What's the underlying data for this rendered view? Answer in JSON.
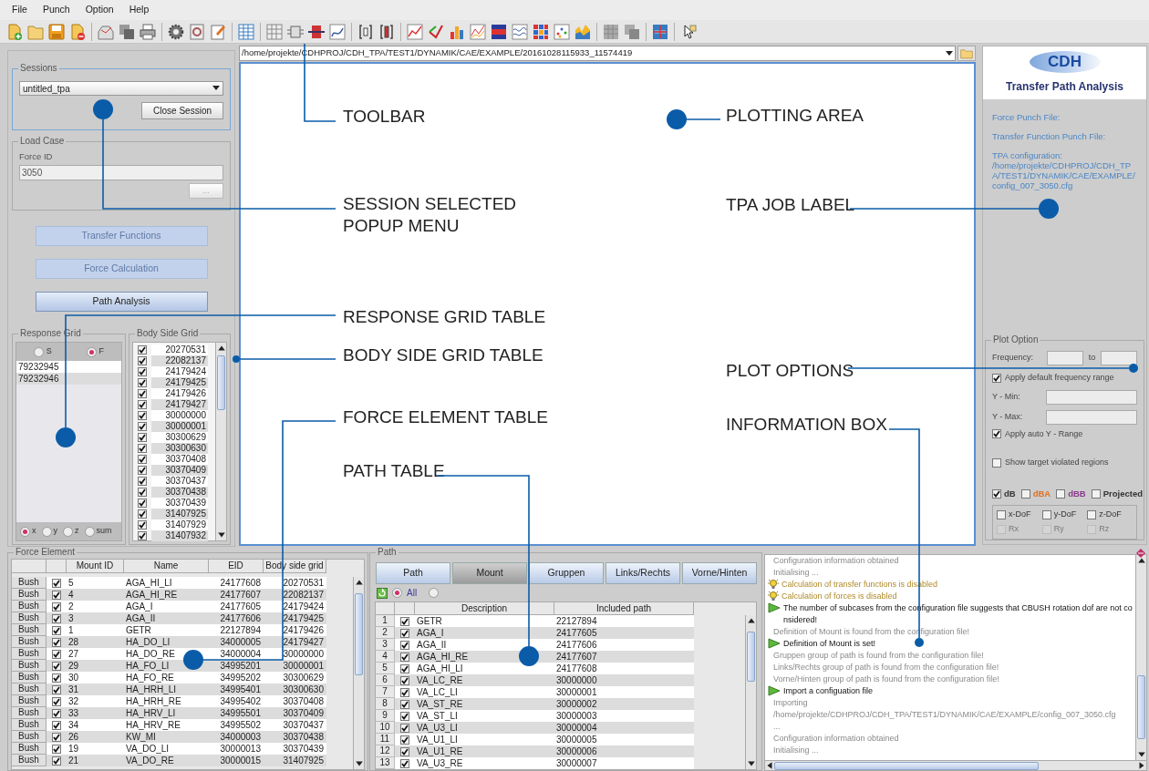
{
  "menu": [
    "File",
    "Punch",
    "Option",
    "Help"
  ],
  "path_field": {
    "value": "/home/projekte/CDHPROJ/CDH_TPA/TEST1/DYNAMIK/CAE/EXAMPLE/20161028115933_11574419"
  },
  "sessions": {
    "legend": "Sessions",
    "value": "untitled_tpa",
    "close_button": "Close Session"
  },
  "load_case": {
    "legend": "Load Case",
    "label": "Force ID",
    "value": "3050",
    "disabled": true,
    "browse_button": "..."
  },
  "actions": [
    {
      "label": "Transfer Functions",
      "disabled": true
    },
    {
      "label": "Force Calculation",
      "disabled": true
    },
    {
      "label": "Path Analysis",
      "disabled": false
    }
  ],
  "response_grid": {
    "legend": "Response Grid",
    "modes": [
      {
        "label": "S",
        "selected": false
      },
      {
        "label": "F",
        "selected": true
      }
    ],
    "rows": [
      "79232945",
      "79232946"
    ],
    "components": [
      {
        "label": "x",
        "selected": true
      },
      {
        "label": "y",
        "selected": false
      },
      {
        "label": "z",
        "selected": false
      },
      {
        "label": "sum",
        "selected": false
      }
    ]
  },
  "body_side_grid": {
    "legend": "Body Side Grid",
    "rows": [
      {
        "id": "20270531",
        "checked": true
      },
      {
        "id": "22082137",
        "checked": true
      },
      {
        "id": "24179424",
        "checked": true
      },
      {
        "id": "24179425",
        "checked": true
      },
      {
        "id": "24179426",
        "checked": true
      },
      {
        "id": "24179427",
        "checked": true
      },
      {
        "id": "30000000",
        "checked": true
      },
      {
        "id": "30000001",
        "checked": true
      },
      {
        "id": "30300629",
        "checked": true
      },
      {
        "id": "30300630",
        "checked": true
      },
      {
        "id": "30370408",
        "checked": true
      },
      {
        "id": "30370409",
        "checked": true
      },
      {
        "id": "30370437",
        "checked": true
      },
      {
        "id": "30370438",
        "checked": true
      },
      {
        "id": "30370439",
        "checked": true
      },
      {
        "id": "31407925",
        "checked": true
      },
      {
        "id": "31407929",
        "checked": true
      },
      {
        "id": "31407932",
        "checked": true
      }
    ]
  },
  "right_panel": {
    "logo": "CDH",
    "title": "Transfer Path Analysis",
    "force_punch": "Force Punch File:",
    "transfer_punch": "Transfer Function Punch File:",
    "config_label": "TPA configuration:",
    "config_path": "/home/projekte/CDHPROJ/CDH_TPA/TEST1/DYNAMIK/CAE/EXAMPLE/config_007_3050.cfg"
  },
  "plot_option": {
    "legend": "Plot Option",
    "frequency_label": "Frequency:",
    "to_label": "to",
    "default_range": {
      "label": "Apply default frequency range",
      "checked": true
    },
    "y_min_label": "Y - Min:",
    "y_max_label": "Y - Max:",
    "auto_y_range": {
      "label": "Apply auto Y - Range",
      "checked": true
    },
    "show_target": {
      "label": "Show target violated regions",
      "checked": false
    },
    "units": [
      {
        "label": "dB",
        "checked": true,
        "color": "#333333"
      },
      {
        "label": "dBA",
        "checked": false,
        "color": "#e07020"
      },
      {
        "label": "dBB",
        "checked": false,
        "color": "#8a3a8a"
      },
      {
        "label": "Projected",
        "checked": false,
        "color": "#333333"
      }
    ],
    "dofs": [
      {
        "label": "x-DoF",
        "checked": false,
        "disabled": false
      },
      {
        "label": "y-DoF",
        "checked": false,
        "disabled": false
      },
      {
        "label": "z-DoF",
        "checked": false,
        "disabled": false
      },
      {
        "label": "Rx",
        "checked": false,
        "disabled": true
      },
      {
        "label": "Ry",
        "checked": false,
        "disabled": true
      },
      {
        "label": "Rz",
        "checked": false,
        "disabled": true
      }
    ]
  },
  "force_element": {
    "legend": "Force Element",
    "columns": [
      "Mount ID",
      "Name",
      "EID",
      "Body side grid"
    ],
    "rows": [
      {
        "type": "Bush",
        "checked": true,
        "mount_id": "5",
        "name": "AGA_HI_LI",
        "eid": "24177608",
        "body_side_grid": "20270531"
      },
      {
        "type": "Bush",
        "checked": true,
        "mount_id": "4",
        "name": "AGA_HI_RE",
        "eid": "24177607",
        "body_side_grid": "22082137"
      },
      {
        "type": "Bush",
        "checked": true,
        "mount_id": "2",
        "name": "AGA_I",
        "eid": "24177605",
        "body_side_grid": "24179424"
      },
      {
        "type": "Bush",
        "checked": true,
        "mount_id": "3",
        "name": "AGA_II",
        "eid": "24177606",
        "body_side_grid": "24179425"
      },
      {
        "type": "Bush",
        "checked": true,
        "mount_id": "1",
        "name": "GETR",
        "eid": "22127894",
        "body_side_grid": "24179426"
      },
      {
        "type": "Bush",
        "checked": true,
        "mount_id": "28",
        "name": "HA_DO_LI",
        "eid": "34000005",
        "body_side_grid": "24179427"
      },
      {
        "type": "Bush",
        "checked": true,
        "mount_id": "27",
        "name": "HA_DO_RE",
        "eid": "34000004",
        "body_side_grid": "30000000"
      },
      {
        "type": "Bush",
        "checked": true,
        "mount_id": "29",
        "name": "HA_FO_LI",
        "eid": "34995201",
        "body_side_grid": "30000001"
      },
      {
        "type": "Bush",
        "checked": true,
        "mount_id": "30",
        "name": "HA_FO_RE",
        "eid": "34995202",
        "body_side_grid": "30300629"
      },
      {
        "type": "Bush",
        "checked": true,
        "mount_id": "31",
        "name": "HA_HRH_LI",
        "eid": "34995401",
        "body_side_grid": "30300630"
      },
      {
        "type": "Bush",
        "checked": true,
        "mount_id": "32",
        "name": "HA_HRH_RE",
        "eid": "34995402",
        "body_side_grid": "30370408"
      },
      {
        "type": "Bush",
        "checked": true,
        "mount_id": "33",
        "name": "HA_HRV_LI",
        "eid": "34995501",
        "body_side_grid": "30370409"
      },
      {
        "type": "Bush",
        "checked": true,
        "mount_id": "34",
        "name": "HA_HRV_RE",
        "eid": "34995502",
        "body_side_grid": "30370437"
      },
      {
        "type": "Bush",
        "checked": true,
        "mount_id": "26",
        "name": "KW_MI",
        "eid": "34000003",
        "body_side_grid": "30370438"
      },
      {
        "type": "Bush",
        "checked": true,
        "mount_id": "19",
        "name": "VA_DO_LI",
        "eid": "30000013",
        "body_side_grid": "30370439"
      },
      {
        "type": "Bush",
        "checked": true,
        "mount_id": "21",
        "name": "VA_DO_RE",
        "eid": "30000015",
        "body_side_grid": "31407925"
      }
    ]
  },
  "path": {
    "legend": "Path",
    "tabs": [
      {
        "label": "Path",
        "selected": false
      },
      {
        "label": "Mount",
        "selected": true
      },
      {
        "label": "Gruppen",
        "selected": false
      },
      {
        "label": "Links/Rechts",
        "selected": false
      },
      {
        "label": "Vorne/Hinten",
        "selected": false
      }
    ],
    "filter": [
      {
        "label": "All",
        "selected": true
      },
      {
        "selected": false
      }
    ],
    "columns": [
      "Description",
      "Included path"
    ],
    "rows": [
      {
        "number": "1",
        "checked": true,
        "description": "GETR",
        "included_path": "22127894"
      },
      {
        "number": "2",
        "checked": true,
        "description": "AGA_I",
        "included_path": "24177605"
      },
      {
        "number": "3",
        "checked": true,
        "description": "AGA_II",
        "included_path": "24177606"
      },
      {
        "number": "4",
        "checked": true,
        "description": "AGA_HI_RE",
        "included_path": "24177607"
      },
      {
        "number": "5",
        "checked": true,
        "description": "AGA_HI_LI",
        "included_path": "24177608"
      },
      {
        "number": "6",
        "checked": true,
        "description": "VA_LC_RE",
        "included_path": "30000000"
      },
      {
        "number": "7",
        "checked": true,
        "description": "VA_LC_LI",
        "included_path": "30000001"
      },
      {
        "number": "8",
        "checked": true,
        "description": "VA_ST_RE",
        "included_path": "30000002"
      },
      {
        "number": "9",
        "checked": true,
        "description": "VA_ST_LI",
        "included_path": "30000003"
      },
      {
        "number": "10",
        "checked": true,
        "description": "VA_U3_LI",
        "included_path": "30000004"
      },
      {
        "number": "11",
        "checked": true,
        "description": "VA_U1_LI",
        "included_path": "30000005"
      },
      {
        "number": "12",
        "checked": true,
        "description": "VA_U1_RE",
        "included_path": "30000006"
      },
      {
        "number": "13",
        "checked": true,
        "description": "VA_U3_RE",
        "included_path": "30000007"
      }
    ]
  },
  "info": {
    "messages": [
      {
        "kind": "plain",
        "text": "Configuration information obtained"
      },
      {
        "kind": "plain",
        "text": "Initialising ..."
      },
      {
        "kind": "warning",
        "text": "Calculation of transfer functions is disabled"
      },
      {
        "kind": "warning",
        "text": "Calculation of forces is disabled"
      },
      {
        "kind": "step",
        "text": "The number of subcases from the configuration file suggests that CBUSH rotation dof are not considered!"
      },
      {
        "kind": "plain",
        "text": "Definition of Mount is found from the configuration file!"
      },
      {
        "kind": "step",
        "text": "Definition of Mount is set!"
      },
      {
        "kind": "plain",
        "text": "Gruppen group of path is found from the configuration file!"
      },
      {
        "kind": "plain",
        "text": "Links/Rechts group of path is found from the configuration file!"
      },
      {
        "kind": "plain",
        "text": "Vorne/Hinten group of path is found from the configuration file!"
      },
      {
        "kind": "step",
        "text": "Import a configuation file"
      },
      {
        "kind": "plain",
        "text": "Importing"
      },
      {
        "kind": "plain",
        "text": "/home/projekte/CDHPROJ/CDH_TPA/TEST1/DYNAMIK/CAE/EXAMPLE/config_007_3050.cfg"
      },
      {
        "kind": "plain",
        "text": "..."
      },
      {
        "kind": "plain",
        "text": "Configuration information obtained"
      },
      {
        "kind": "plain",
        "text": "Initialising ..."
      }
    ]
  },
  "annotations": [
    {
      "label": "TOOLBAR"
    },
    {
      "label": "PLOTTING AREA"
    },
    {
      "label": "SESSION SELECTED POPUP MENU"
    },
    {
      "label": "TPA JOB LABEL"
    },
    {
      "label": "RESPONSE GRID TABLE"
    },
    {
      "label": "BODY SIDE GRID TABLE"
    },
    {
      "label": "PLOT OPTIONS"
    },
    {
      "label": "FORCE ELEMENT TABLE"
    },
    {
      "label": "INFORMATION BOX"
    },
    {
      "label": "PATH TABLE"
    }
  ]
}
